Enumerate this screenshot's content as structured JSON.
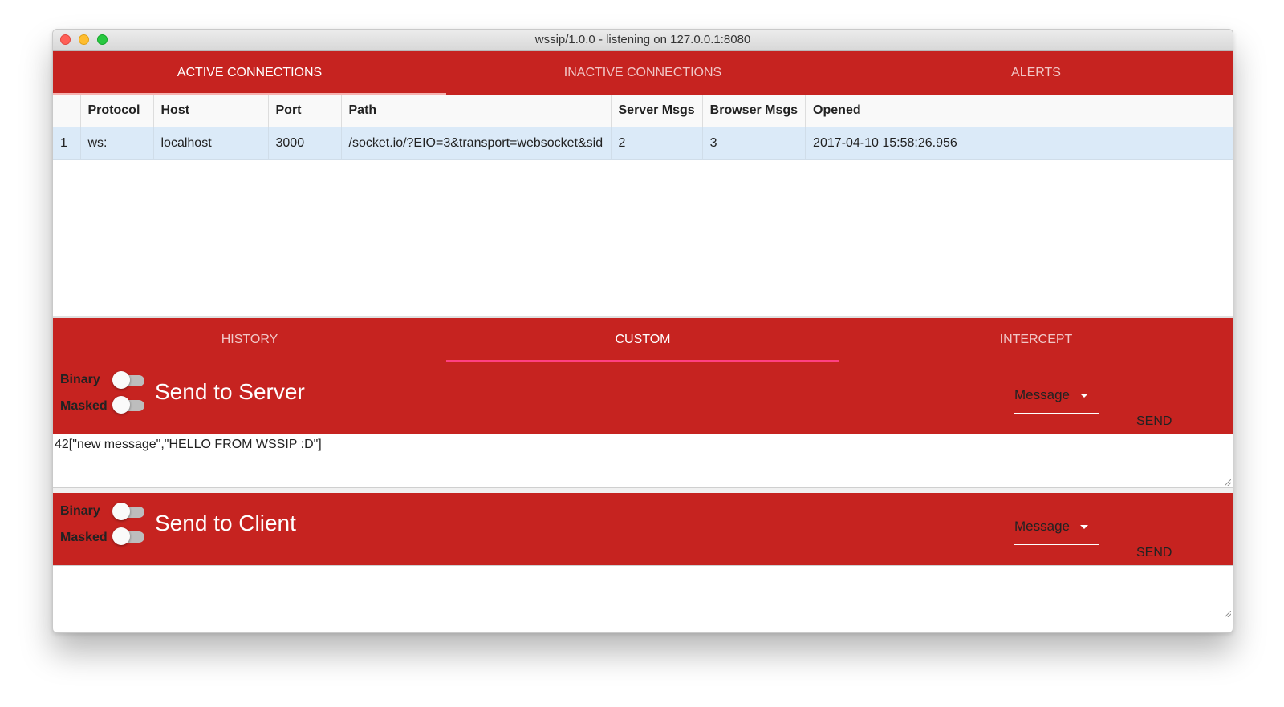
{
  "window": {
    "title": "wssip/1.0.0 - listening on 127.0.0.1:8080"
  },
  "top_tabs": [
    {
      "label": "ACTIVE CONNECTIONS",
      "active": true
    },
    {
      "label": "INACTIVE CONNECTIONS",
      "active": false
    },
    {
      "label": "ALERTS",
      "active": false
    }
  ],
  "connections": {
    "columns": [
      "",
      "Protocol",
      "Host",
      "Port",
      "Path",
      "Server Msgs",
      "Browser Msgs",
      "Opened"
    ],
    "rows": [
      {
        "index": "1",
        "protocol": "ws:",
        "host": "localhost",
        "port": "3000",
        "path": "/socket.io/?EIO=3&transport=websocket&sid",
        "server_msgs": "2",
        "browser_msgs": "3",
        "opened": "2017-04-10 15:58:26.956",
        "selected": true
      }
    ]
  },
  "bottom_tabs": [
    {
      "label": "HISTORY",
      "active": false
    },
    {
      "label": "CUSTOM",
      "active": true
    },
    {
      "label": "INTERCEPT",
      "active": false
    }
  ],
  "send_server": {
    "binary_label": "Binary",
    "masked_label": "Masked",
    "binary_on": false,
    "masked_on": false,
    "title": "Send to Server",
    "type_value": "Message",
    "send_label": "SEND",
    "message": "42[\"new message\",\"HELLO FROM WSSIP :D\"]"
  },
  "send_client": {
    "binary_label": "Binary",
    "masked_label": "Masked",
    "binary_on": false,
    "masked_on": false,
    "title": "Send to Client",
    "type_value": "Message",
    "send_label": "SEND",
    "message": ""
  },
  "colors": {
    "accent": "#c62320",
    "selected_row": "#dbeaf8",
    "tab_indicator": "#ff4081"
  }
}
